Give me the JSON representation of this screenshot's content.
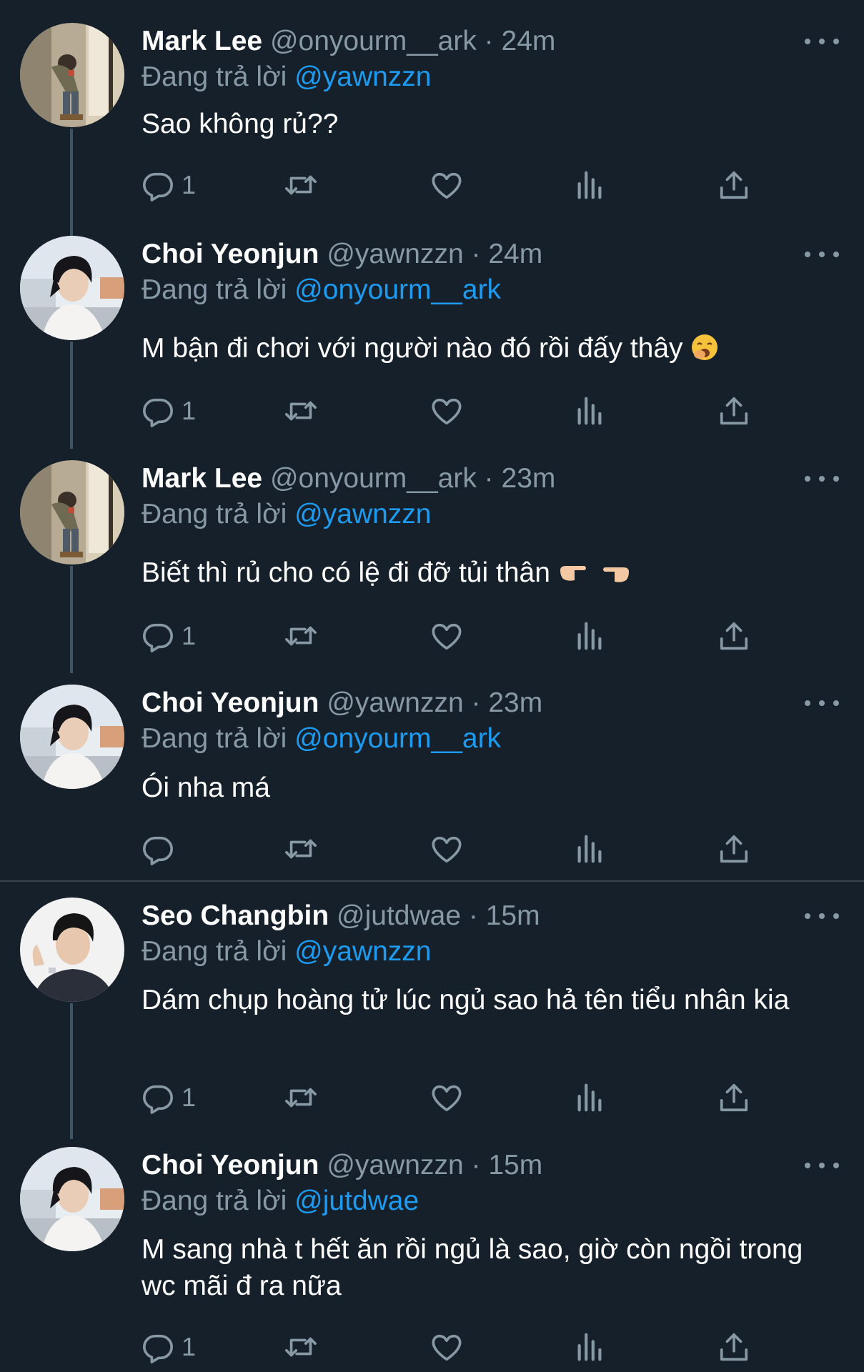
{
  "replying_label": "Đang trả lời",
  "tweets": [
    {
      "name": "Mark Lee",
      "handle": "@onyourm__ark",
      "time": "24m",
      "reply_to": "@yawnzzn",
      "text": "Sao không rủ??",
      "reply_count": "1"
    },
    {
      "name": "Choi Yeonjun",
      "handle": "@yawnzzn",
      "time": "24m",
      "reply_to": "@onyourm__ark",
      "text": "M bận đi chơi với người nào đó rồi đấy thây",
      "emoji": "yawning-face-emoji",
      "reply_count": "1"
    },
    {
      "name": "Mark Lee",
      "handle": "@onyourm__ark",
      "time": "23m",
      "reply_to": "@yawnzzn",
      "text": "Biết thì rủ cho có lệ đi đỡ tủi thân",
      "emoji": "pointing-fingers-emoji",
      "reply_count": "1"
    },
    {
      "name": "Choi Yeonjun",
      "handle": "@yawnzzn",
      "time": "23m",
      "reply_to": "@onyourm__ark",
      "text": "Ói nha má",
      "reply_count": ""
    },
    {
      "name": "Seo Changbin",
      "handle": "@jutdwae",
      "time": "15m",
      "reply_to": "@yawnzzn",
      "text": "Dám chụp hoàng tử lúc ngủ sao hả tên tiểu nhân kia",
      "reply_count": "1"
    },
    {
      "name": "Choi Yeonjun",
      "handle": "@yawnzzn",
      "time": "15m",
      "reply_to": "@jutdwae",
      "text": "M sang nhà t hết ăn rồi ngủ là sao, giờ còn ngồi trong wc mãi đ ra nữa",
      "reply_count": "1"
    }
  ],
  "icons": {
    "reply": "reply-icon",
    "retweet": "retweet-icon",
    "like": "heart-icon",
    "analytics": "analytics-icon",
    "share": "share-icon",
    "more": "more-icon"
  },
  "colors": {
    "background": "#15202b",
    "secondary_text": "#8899a6",
    "mention": "#1d9bf0",
    "thread_line": "#3d5466"
  }
}
